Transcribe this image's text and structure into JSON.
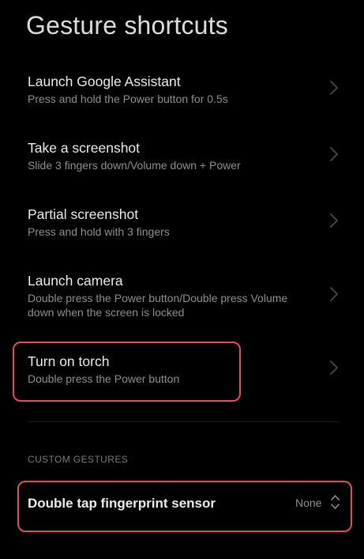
{
  "header": {
    "title": "Gesture shortcuts"
  },
  "shortcuts": [
    {
      "title": "Launch Google Assistant",
      "subtitle": "Press and hold the Power button for 0.5s"
    },
    {
      "title": "Take a screenshot",
      "subtitle": "Slide 3 fingers down/Volume down + Power"
    },
    {
      "title": "Partial screenshot",
      "subtitle": "Press and hold with 3 fingers"
    },
    {
      "title": "Launch camera",
      "subtitle": "Double press the Power button/Double press Volume down when the screen is locked"
    },
    {
      "title": "Turn on torch",
      "subtitle": "Double press the Power button"
    }
  ],
  "custom_gestures": {
    "section_label": "CUSTOM GESTURES",
    "items": [
      {
        "title": "Double tap fingerprint sensor",
        "value": "None"
      }
    ]
  },
  "icons": {
    "row_chevron": "chevron-right-icon",
    "select_arrows": "up-down-chevron-icon"
  },
  "colors": {
    "background": "#000000",
    "title_text": "#ececec",
    "subtitle_text": "#8f8f8f",
    "highlight_annotation": "#e0505a"
  }
}
